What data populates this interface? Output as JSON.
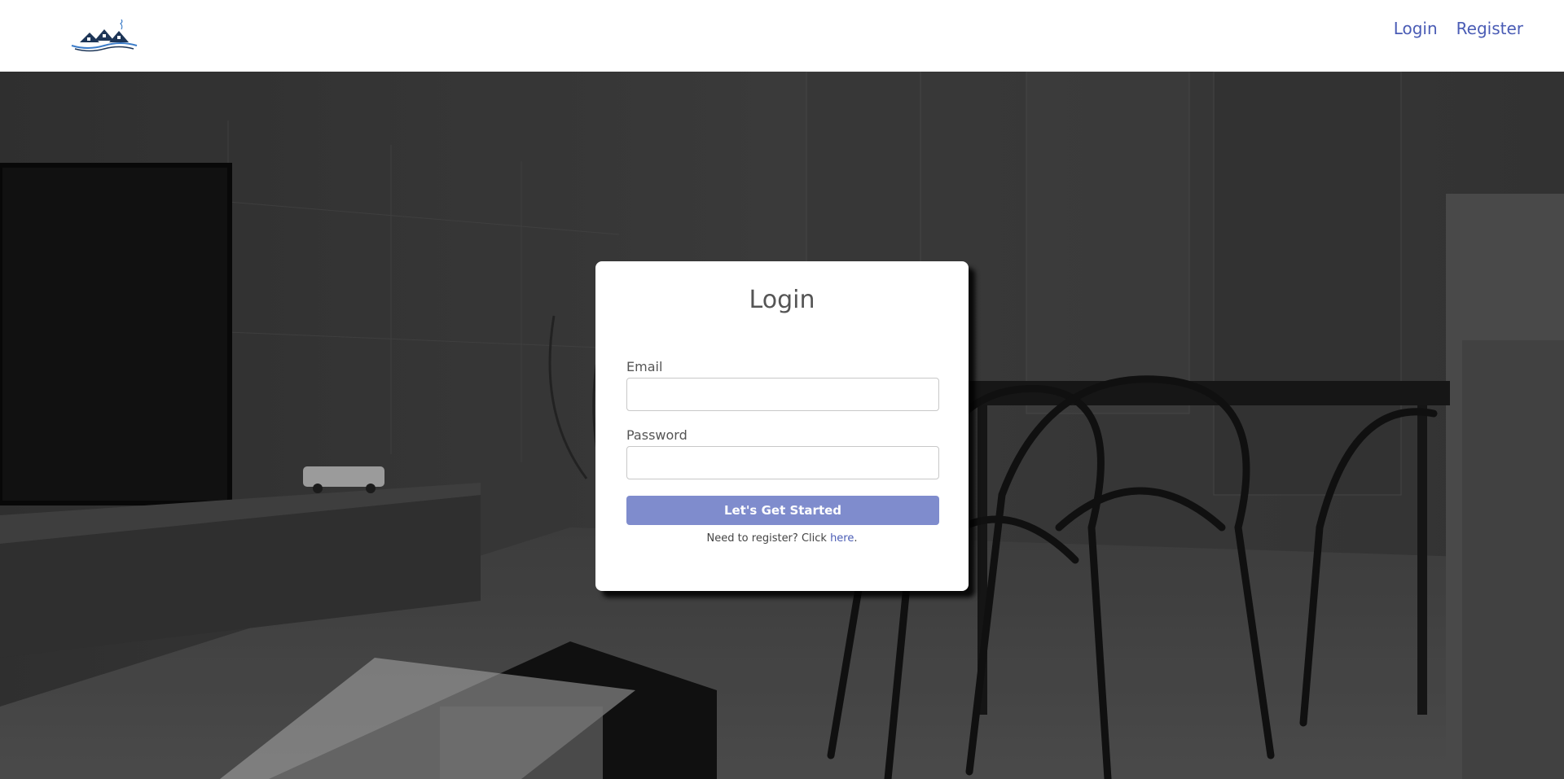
{
  "nav": {
    "logo_alt": "Home logo",
    "login_label": "Login",
    "register_label": "Register"
  },
  "login_card": {
    "title": "Login",
    "email_label": "Email",
    "email_value": "",
    "password_label": "Password",
    "password_value": "",
    "submit_label": "Let's Get Started",
    "register_prompt": "Need to register? Click ",
    "register_link": "here",
    "register_suffix": "."
  },
  "colors": {
    "accent": "#4a5cb5",
    "button": "#7f8ccd",
    "background_overlay": "#3c3c3c"
  },
  "icons": {
    "logo": "houses-on-water-logo"
  }
}
